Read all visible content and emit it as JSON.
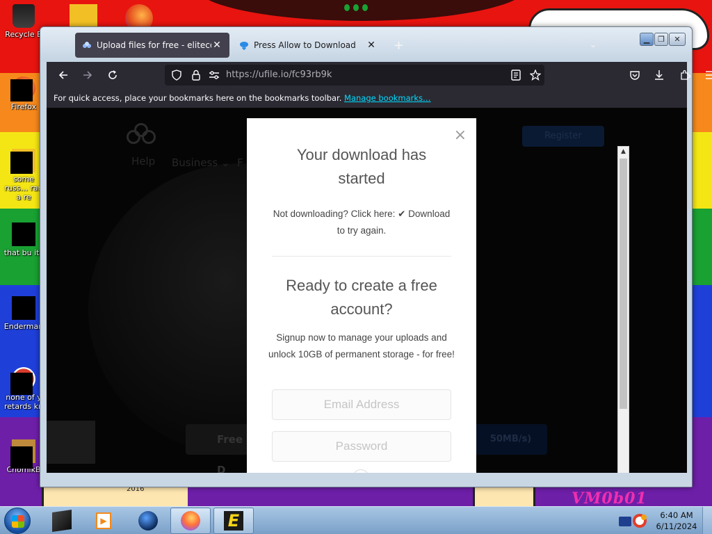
{
  "desktop": {
    "icons": [
      {
        "label": "Recycle B",
        "kind": "recycle-bin-icon"
      },
      {
        "label": "Firefox",
        "kind": "firefox-icon"
      },
      {
        "label": "some russ... ran a re",
        "kind": "file-icon"
      },
      {
        "label": "that bu its",
        "kind": "folder-icon"
      },
      {
        "label": "Enderman",
        "kind": "program-icon"
      },
      {
        "label": "none of y retards kn",
        "kind": "app-icon"
      },
      {
        "label": "ChomikB",
        "kind": "chomikbox-icon"
      }
    ],
    "wallpaper_text": "VM0b01",
    "wallpaper_year": "2016"
  },
  "browser": {
    "tabs": [
      {
        "title": "Upload files for free - elitecode",
        "favicon": "ufile-icon",
        "active": true
      },
      {
        "title": "Press Allow to Download",
        "favicon": "download-cloud-icon",
        "active": false
      }
    ],
    "new_tab_symbol": "+",
    "url": "https://ufile.io/fc93rb9k",
    "bookmarks_bar_text": "For quick access, place your bookmarks here on the bookmarks toolbar.",
    "bookmarks_link": "Manage bookmarks…"
  },
  "page": {
    "nav_business": "Business ⌄",
    "nav_f": "F",
    "help": "Help",
    "register": "Register",
    "free_button": "Free D",
    "speed_button": "50MB/s)"
  },
  "modal": {
    "close_symbol": "×",
    "title_line1": "Your download has",
    "title_line2": "started",
    "not_downloading": "Not downloading? Click here: ✔ Download",
    "try_again": "to try again.",
    "signup_title_line1": "Ready to create a free",
    "signup_title_line2": "account?",
    "signup_text_line1": "Signup now to manage your uploads and",
    "signup_text_line2": "unlock 10GB of permanent storage - for free!",
    "email_placeholder": "Email Address",
    "password_placeholder": "Password"
  },
  "taskbar": {
    "time": "6:40 AM",
    "date": "6/11/2024",
    "pinned": [
      "cube-icon",
      "media-player-icon",
      "browser-globe-icon",
      "firefox-icon",
      "e-app-icon"
    ]
  },
  "colors": {
    "tab_active_bg": "#42414d",
    "toolbar_bg": "#2b2a33",
    "link_color": "#00ddff",
    "modal_bg": "#ffffff"
  }
}
